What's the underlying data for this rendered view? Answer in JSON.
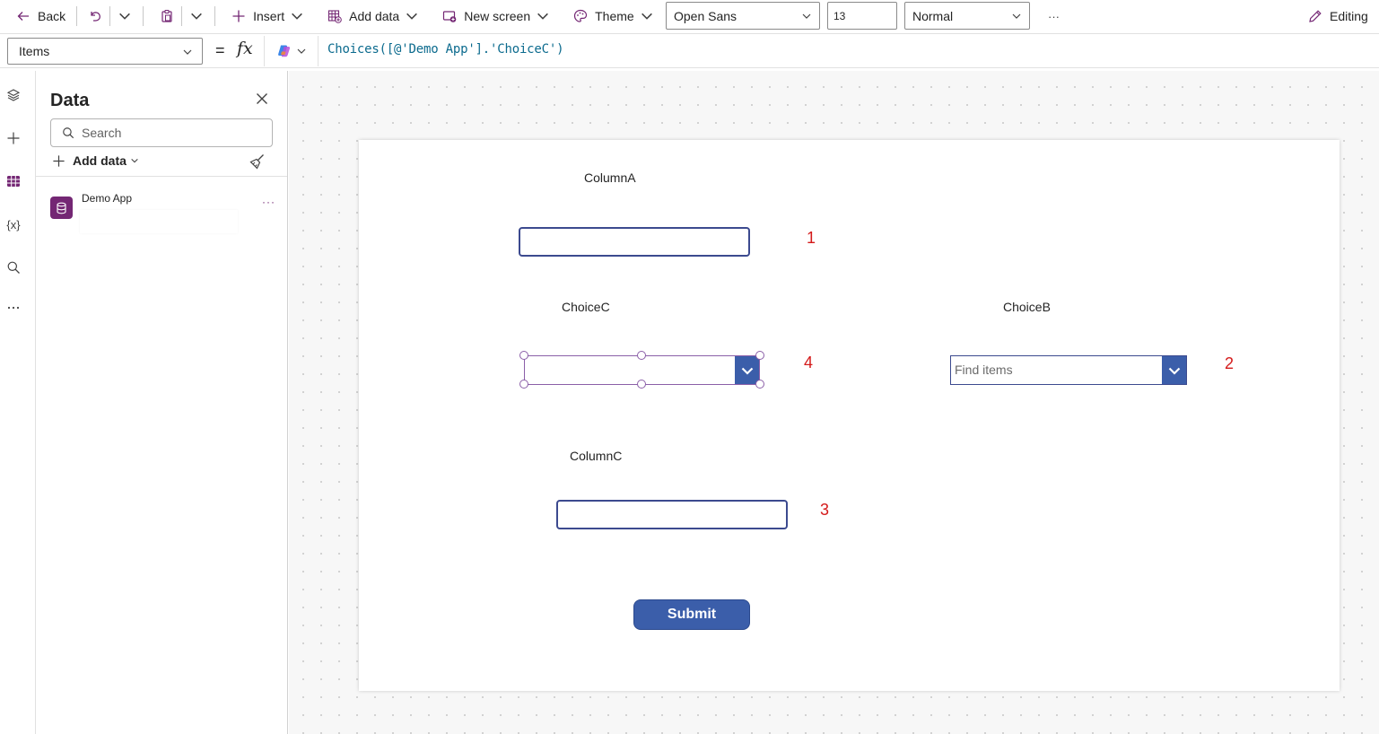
{
  "toolbar": {
    "back_label": "Back",
    "insert_label": "Insert",
    "add_data_label": "Add data",
    "new_screen_label": "New screen",
    "theme_label": "Theme",
    "font_value": "Open Sans",
    "font_size_value": "13",
    "font_weight_value": "Normal",
    "more_label": "···",
    "editing_label": "Editing"
  },
  "formula_bar": {
    "property_value": "Items",
    "equals": "=",
    "fx": "fx",
    "formula": "Choices([@'Demo App'].'ChoiceC')"
  },
  "rail": {
    "icons": [
      "layers-icon",
      "plus-icon",
      "data-icon",
      "variables-icon",
      "search-icon",
      "more-icon"
    ],
    "variables_glyph": "{x}",
    "active_color": "#742774"
  },
  "data_panel": {
    "title": "Data",
    "search_placeholder": "Search",
    "add_data_label": "Add data",
    "sources": [
      {
        "name": "Demo App",
        "more": "···"
      }
    ]
  },
  "screen": {
    "labels": {
      "column_a": "ColumnA",
      "choice_c": "ChoiceC",
      "choice_b": "ChoiceB",
      "column_c": "ColumnC"
    },
    "choice_b_placeholder": "Find items",
    "annotations": [
      "1",
      "4",
      "2",
      "3"
    ],
    "submit_label": "Submit"
  },
  "colors": {
    "accent": "#742774",
    "control_border": "#3c4a8f",
    "button_fill": "#3b5eaa",
    "annotation": "#d41a1a",
    "formula_text": "#0c6b8e"
  }
}
